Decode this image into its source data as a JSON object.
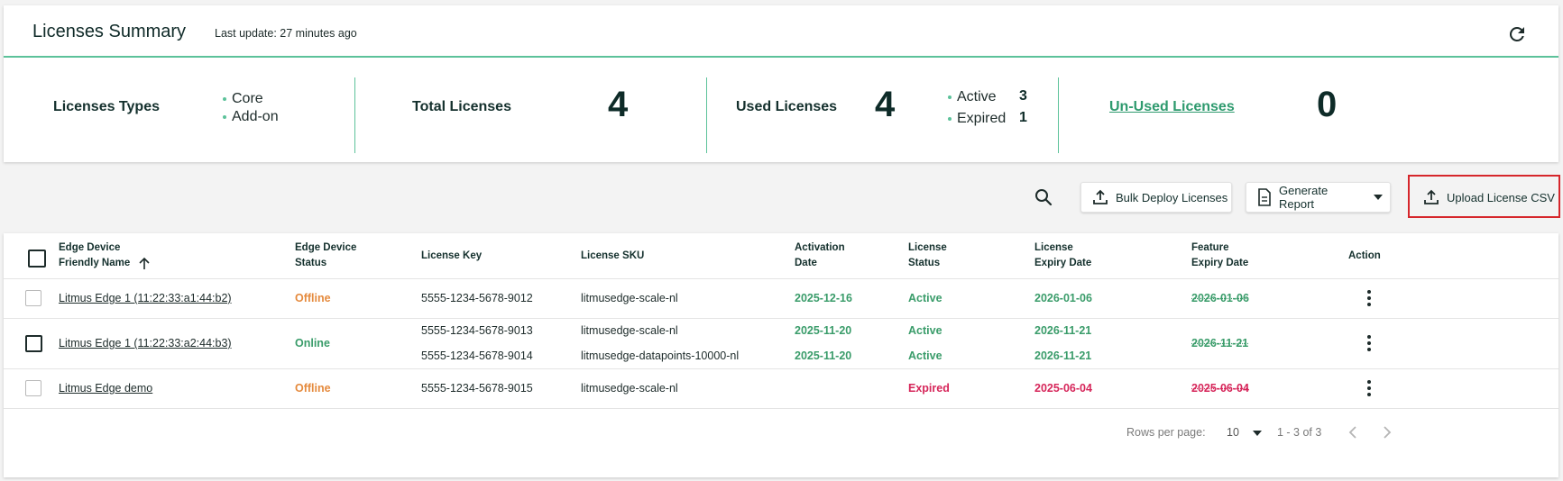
{
  "header": {
    "title": "Licenses Summary",
    "last_update": "Last update: 27 minutes ago",
    "refresh_icon": "refresh-icon"
  },
  "stats": {
    "types": {
      "label": "Licenses Types",
      "items": [
        "Core",
        "Add-on"
      ]
    },
    "total": {
      "label": "Total Licenses",
      "value": "4"
    },
    "used": {
      "label": "Used Licenses",
      "value": "4",
      "breakdown": [
        {
          "label": "Active",
          "value": "3"
        },
        {
          "label": "Expired",
          "value": "1"
        }
      ]
    },
    "unused": {
      "label": "Un-Used Licenses",
      "value": "0"
    }
  },
  "toolbar": {
    "search_icon": "search-icon",
    "bulk_deploy": "Bulk Deploy Licenses",
    "generate_report": "Generate Report",
    "upload_csv": "Upload License CSV"
  },
  "table": {
    "headers": {
      "device_name_1": "Edge Device",
      "device_name_2": "Friendly Name",
      "device_status_1": "Edge Device",
      "device_status_2": "Status",
      "license_key": "License Key",
      "license_sku": "License SKU",
      "activation_1": "Activation",
      "activation_2": "Date",
      "license_status_1": "License",
      "license_status_2": "Status",
      "expiry_1": "License",
      "expiry_2": "Expiry Date",
      "feature_1": "Feature",
      "feature_2": "Expiry Date",
      "action": "Action"
    },
    "rows": [
      {
        "device": "Litmus Edge 1 (11:22:33:a1:44:b2)",
        "status": "Offline",
        "licenses": [
          {
            "key": "5555-1234-5678-9012",
            "sku": "litmusedge-scale-nl",
            "activation": "2025-12-16",
            "lic_status": "Active",
            "expiry": "2026-01-06"
          }
        ],
        "feature_expiry": "2026-01-06"
      },
      {
        "device": "Litmus Edge 1 (11:22:33:a2:44:b3)",
        "status": "Online",
        "licenses": [
          {
            "key": "5555-1234-5678-9013",
            "sku": "litmusedge-scale-nl",
            "activation": "2025-11-20",
            "lic_status": "Active",
            "expiry": "2026-11-21"
          },
          {
            "key": "5555-1234-5678-9014",
            "sku": "litmusedge-datapoints-10000-nl",
            "activation": "2025-11-20",
            "lic_status": "Active",
            "expiry": "2026-11-21"
          }
        ],
        "feature_expiry": "2026-11-21"
      },
      {
        "device": "Litmus Edge demo",
        "status": "Offline",
        "licenses": [
          {
            "key": "5555-1234-5678-9015",
            "sku": "litmusedge-scale-nl",
            "activation": "",
            "lic_status": "Expired",
            "expiry": "2025-06-04"
          }
        ],
        "feature_expiry": "2025-06-04"
      }
    ]
  },
  "footer": {
    "rows_per_page_label": "Rows per page:",
    "rows_per_page_value": "10",
    "range": "1 - 3 of 3"
  },
  "colors": {
    "accent_green": "#5cc29a",
    "status_green": "#3a9c6a",
    "status_orange": "#e58a3d",
    "status_red": "#d6265a",
    "highlight_red": "#d6262b"
  }
}
